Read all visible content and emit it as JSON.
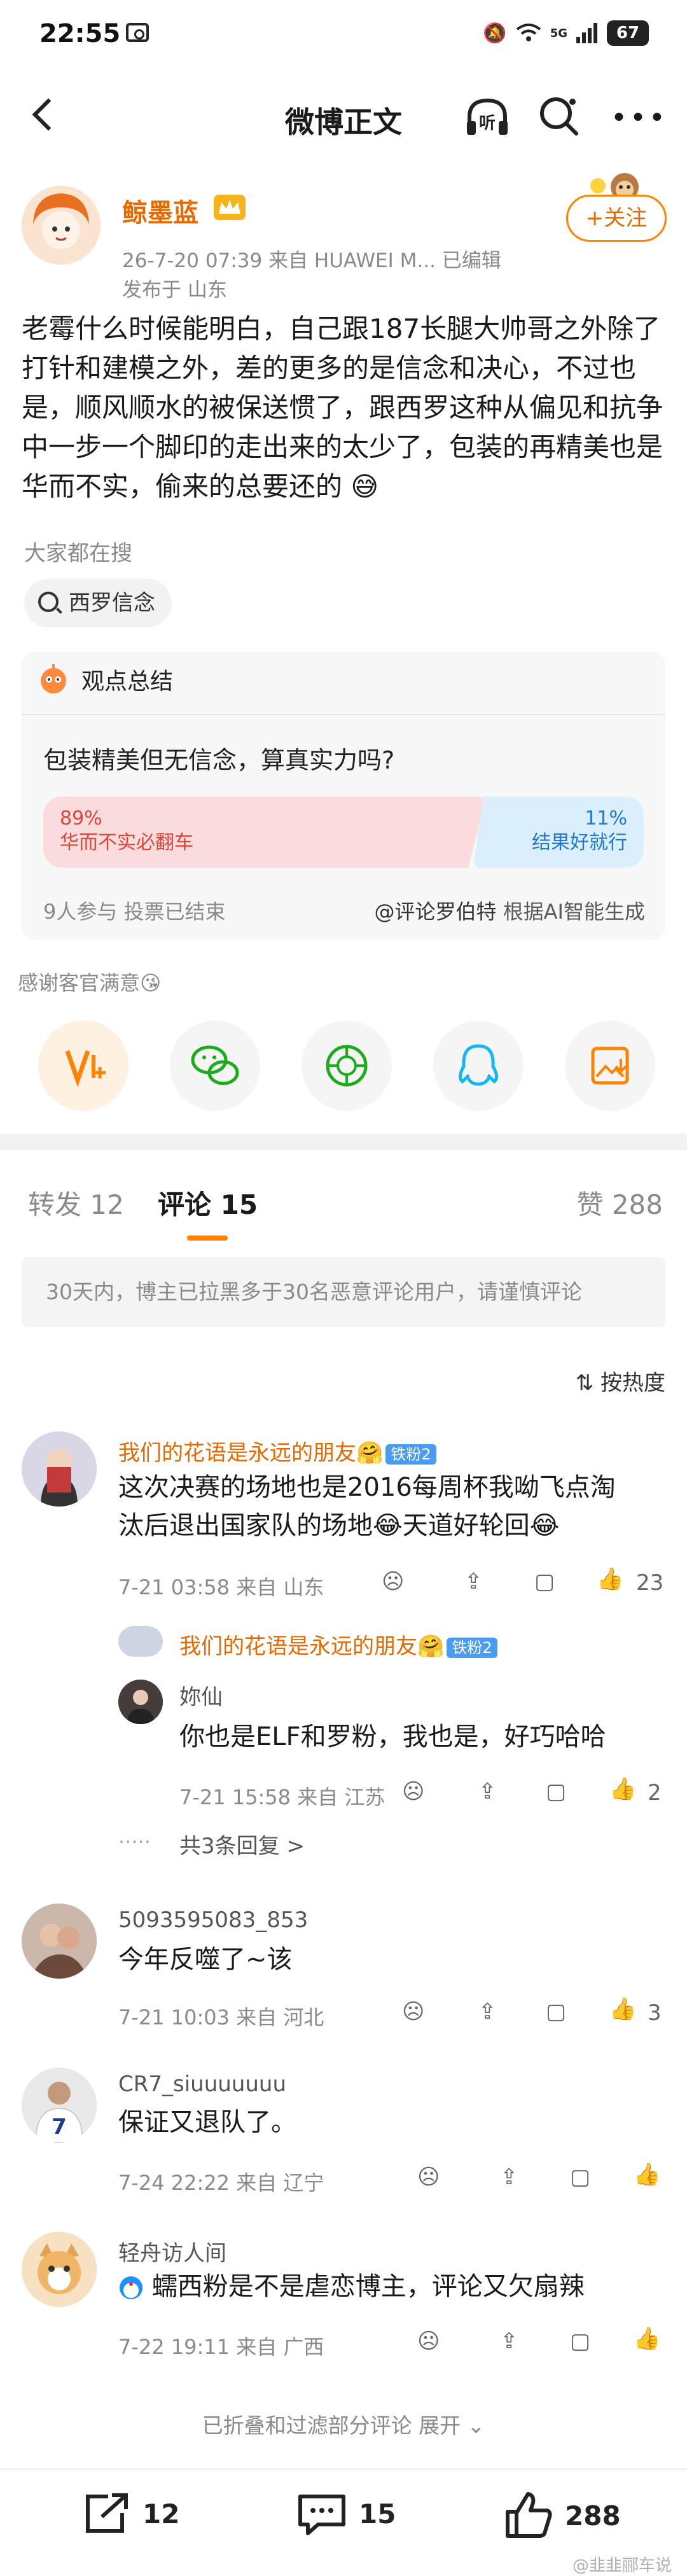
{
  "status_bar": {
    "time": "22:55",
    "signal": "5G",
    "battery": "67"
  },
  "header": {
    "title": "微博正文"
  },
  "post": {
    "author": "鲸墨蓝",
    "meta": "26-7-20 07:39  来自 HUAWEI M...   已编辑",
    "location": "发布于 山东",
    "follow_label": "+关注",
    "body": "老霉什么时候能明白，自己跟187长腿大帅哥之外除了打针和建模之外，差的更多的是信念和决心，不过也是，顺风顺水的被保送惯了，跟西罗这种从偏见和抗争中一步一个脚印的走出来的太少了，包装的再精美也是华而不实，偷来的总要还的",
    "search_label": "大家都在搜",
    "search_chip": "西罗信念"
  },
  "poll": {
    "title": "观点总结",
    "question": "包装精美但无信念，算真实力吗?",
    "option_a_pct": "89%",
    "option_a_label": "华而不实必翻车",
    "option_b_pct": "11%",
    "option_b_label": "结果好就行",
    "footer": "9人参与  投票已结束",
    "source_link": "@评论罗伯特",
    "source_suffix": " 根据AI智能生成"
  },
  "thanks": "感谢客官满意",
  "share_icons": [
    "vplus-icon",
    "wechat-icon",
    "moments-icon",
    "qq-icon",
    "save-image-icon"
  ],
  "tabs": {
    "repost": "转发 12",
    "comments": "评论 15",
    "likes": "赞 288"
  },
  "notice": "30天内，博主已拉黑多于30名恶意评论用户，请谨慎评论",
  "sort": "按热度",
  "comments": [
    {
      "name": "我们的花语是永远的朋友",
      "badge": "铁粉2",
      "text_line1": "这次决赛的场地也是2016每周杯我呦飞点淘",
      "text_line2": "汰后退出国家队的场地😂天道好轮回😂",
      "meta": "7-21 03:58  来自 山东",
      "likes": "23",
      "reply": {
        "name": "我们的花语是永远的朋友",
        "badge": "铁粉2",
        "sub_name": "妳仙",
        "sub_text": "你也是ELF和罗粉，我也是，好巧哈哈",
        "sub_meta": "7-21 15:58  来自 江苏",
        "sub_likes": "2",
        "more": "共3条回复 >"
      }
    },
    {
      "name": "5093595083_853",
      "text": "今年反噬了~该",
      "meta": "7-21 10:03  来自 河北",
      "likes": "3"
    },
    {
      "name": "CR7_siuuuuuuu",
      "text": "保证又退队了。",
      "meta": "7-24 22:22  来自 辽宁",
      "likes": ""
    },
    {
      "name": "轻舟访人间",
      "text": "蠕西粉是不是虐恋博主，评论又欠扇辣",
      "meta": "7-22 19:11  来自 广西",
      "likes": ""
    }
  ],
  "folded_note": "已折叠和过滤部分评论 展开 ⌄",
  "bottom_bar": {
    "repost_count": "12",
    "comment_count": "15",
    "like_count": "288"
  },
  "watermark": "@韭韭郦车说",
  "colors": {
    "accent": "#ff8200",
    "name_orange": "#e66a00",
    "poll_red": "#e0453a",
    "poll_blue": "#1f78d1"
  }
}
